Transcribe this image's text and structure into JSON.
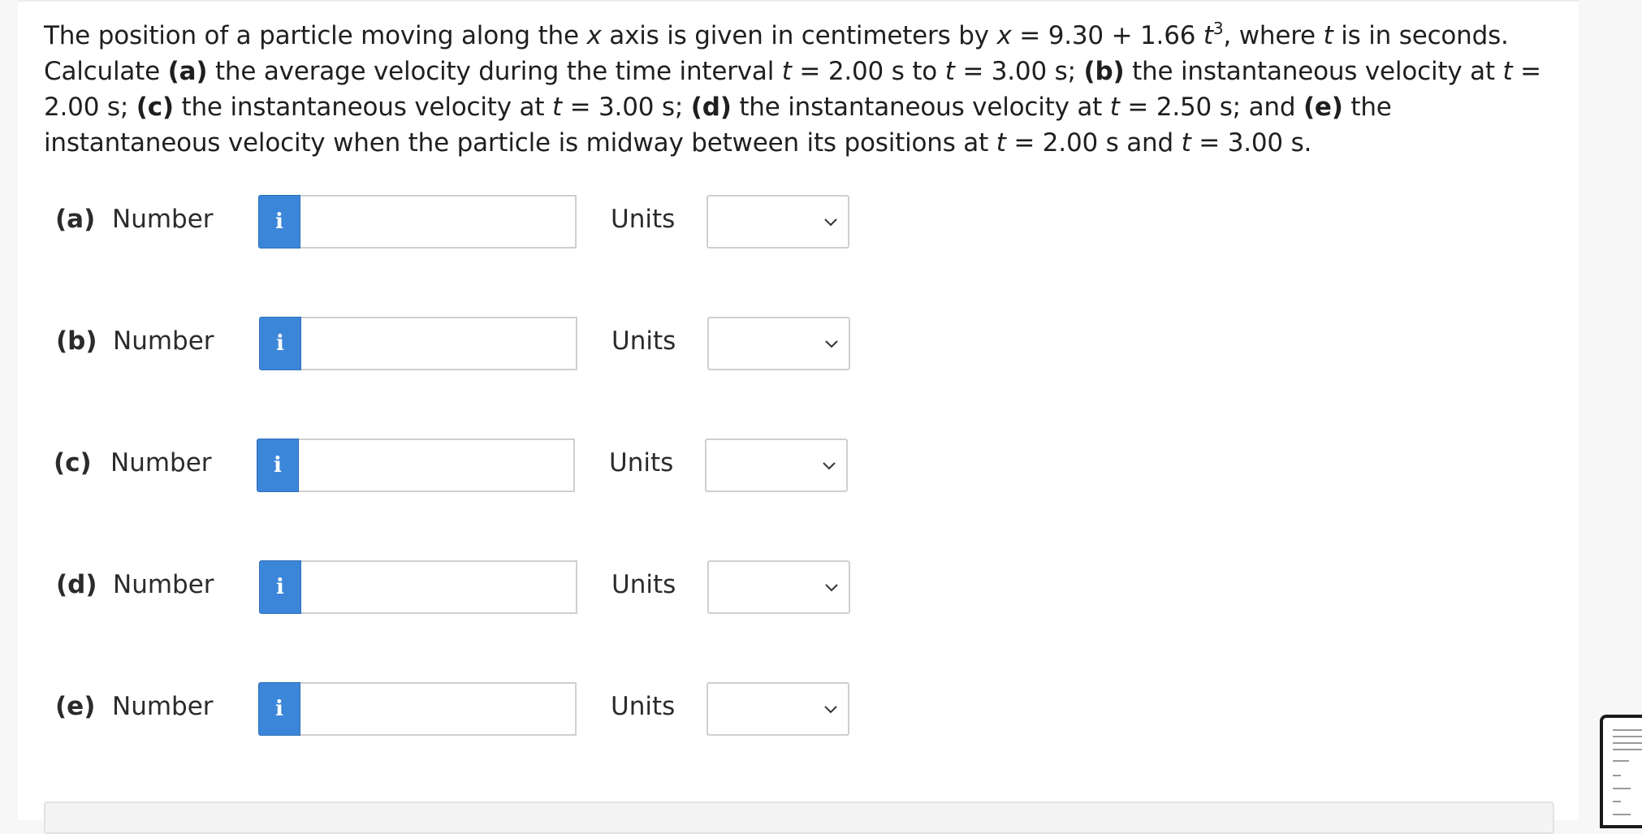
{
  "question": {
    "seg1": "The position of a particle moving along the ",
    "var_x1": "x",
    "seg2": " axis is given in centimeters by ",
    "var_x2": "x",
    "seg3": " = 9.30 + 1.66 ",
    "var_t1": "t",
    "exp": "3",
    "seg4": ", where ",
    "var_t2": "t",
    "seg5": " is in seconds. Calculate ",
    "mark_a": "(a)",
    "seg6": " the average velocity during the time interval ",
    "var_t3": "t",
    "seg7": " = 2.00 s to ",
    "var_t4": "t",
    "seg8": " = 3.00 s; ",
    "mark_b": "(b)",
    "seg9": " the instantaneous velocity at ",
    "var_t5": "t",
    "seg10": " = 2.00 s; ",
    "mark_c": "(c)",
    "seg11": " the instantaneous velocity at ",
    "var_t6": "t",
    "seg12": " = 3.00 s; ",
    "mark_d": "(d)",
    "seg13": " the instantaneous velocity at ",
    "var_t7": "t",
    "seg14": " = 2.50 s; and ",
    "mark_e": "(e)",
    "seg15": " the instantaneous velocity when the particle is midway between its positions at ",
    "var_t8": "t",
    "seg16": " = 2.00 s and ",
    "var_t9": "t",
    "seg17": " = 3.00 s."
  },
  "parts": [
    {
      "label": "(a)",
      "number_label": "Number",
      "info_icon": "i",
      "value": "",
      "units_label": "Units",
      "units_value": ""
    },
    {
      "label": "(b)",
      "number_label": "Number",
      "info_icon": "i",
      "value": "",
      "units_label": "Units",
      "units_value": ""
    },
    {
      "label": "(c)",
      "number_label": "Number",
      "info_icon": "i",
      "value": "",
      "units_label": "Units",
      "units_value": ""
    },
    {
      "label": "(d)",
      "number_label": "Number",
      "info_icon": "i",
      "value": "",
      "units_label": "Units",
      "units_value": ""
    },
    {
      "label": "(e)",
      "number_label": "Number",
      "info_icon": "i",
      "value": "",
      "units_label": "Units",
      "units_value": ""
    }
  ],
  "colors": {
    "info_button": "#3b86d9",
    "text": "#1f1f1f",
    "input_border": "#cfcfcf"
  }
}
